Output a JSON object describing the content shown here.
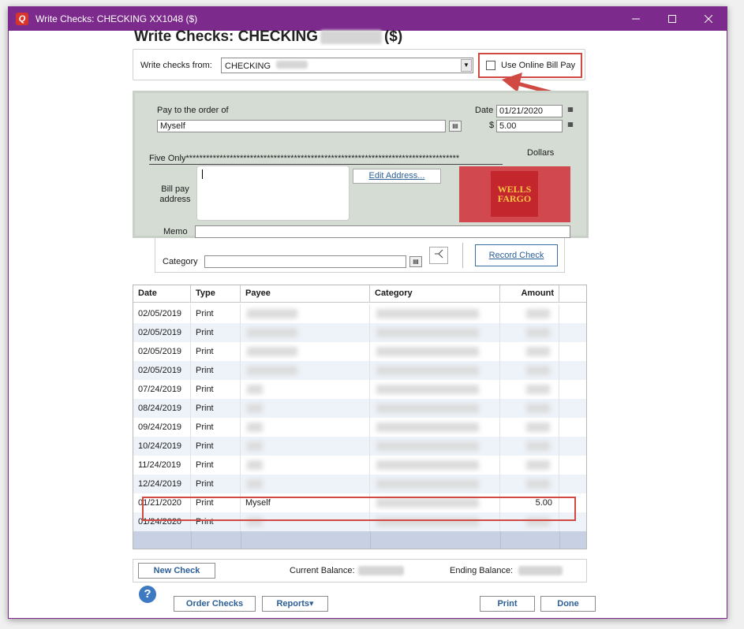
{
  "window": {
    "title": "Write Checks: CHECKING XX1048 ($)",
    "controls": [
      "minimize",
      "maximize",
      "close"
    ]
  },
  "heading": {
    "prefix": "Write Checks: CHECKING",
    "suffix": "($)"
  },
  "from": {
    "label": "Write checks from:",
    "account": "CHECKING",
    "online_label": "Use Online Bill Pay",
    "online_checked": false
  },
  "check": {
    "pay_to_label": "Pay to the order of",
    "payee": "Myself",
    "date_label": "Date",
    "date": "01/21/2020",
    "dollar_sign": "$",
    "amount": "5.00",
    "amount_words": "Five Only*********************************************************************************",
    "dollars_label": "Dollars",
    "bill_pay_label_1": "Bill pay",
    "bill_pay_label_2": "address",
    "edit_address": "Edit Address...",
    "memo_label": "Memo",
    "memo": "",
    "logo_line1": "WELLS",
    "logo_line2": "FARGO"
  },
  "category": {
    "label": "Category",
    "value": "",
    "record_button": "Record Check"
  },
  "register": {
    "columns": [
      "Date",
      "Type",
      "Payee",
      "Category",
      "Amount"
    ],
    "rows": [
      {
        "date": "02/05/2019",
        "type": "Print",
        "payee": "",
        "category": "",
        "amount": ""
      },
      {
        "date": "02/05/2019",
        "type": "Print",
        "payee": "",
        "category": "",
        "amount": ""
      },
      {
        "date": "02/05/2019",
        "type": "Print",
        "payee": "",
        "category": "",
        "amount": ""
      },
      {
        "date": "02/05/2019",
        "type": "Print",
        "payee": "",
        "category": "",
        "amount": ""
      },
      {
        "date": "07/24/2019",
        "type": "Print",
        "payee": "",
        "category": "",
        "amount": ""
      },
      {
        "date": "08/24/2019",
        "type": "Print",
        "payee": "",
        "category": "",
        "amount": ""
      },
      {
        "date": "09/24/2019",
        "type": "Print",
        "payee": "",
        "category": "",
        "amount": ""
      },
      {
        "date": "10/24/2019",
        "type": "Print",
        "payee": "",
        "category": "",
        "amount": ""
      },
      {
        "date": "11/24/2019",
        "type": "Print",
        "payee": "",
        "category": "",
        "amount": ""
      },
      {
        "date": "12/24/2019",
        "type": "Print",
        "payee": "",
        "category": "",
        "amount": ""
      },
      {
        "date": "01/21/2020",
        "type": "Print",
        "payee": "Myself",
        "category": "",
        "amount": "5.00"
      },
      {
        "date": "01/24/2020",
        "type": "Print",
        "payee": "",
        "category": "",
        "amount": ""
      }
    ]
  },
  "footer": {
    "new_check": "New Check",
    "current_balance_label": "Current Balance:",
    "ending_balance_label": "Ending Balance:",
    "help": "?",
    "order_checks": "Order Checks",
    "reports": "Reports",
    "reports_arrow": "▾",
    "print": "Print",
    "done": "Done"
  },
  "colors": {
    "titlebar": "#7d2a8d",
    "highlight": "#d04a43",
    "check_bg": "#d4dcd4",
    "link": "#2c5f97"
  }
}
